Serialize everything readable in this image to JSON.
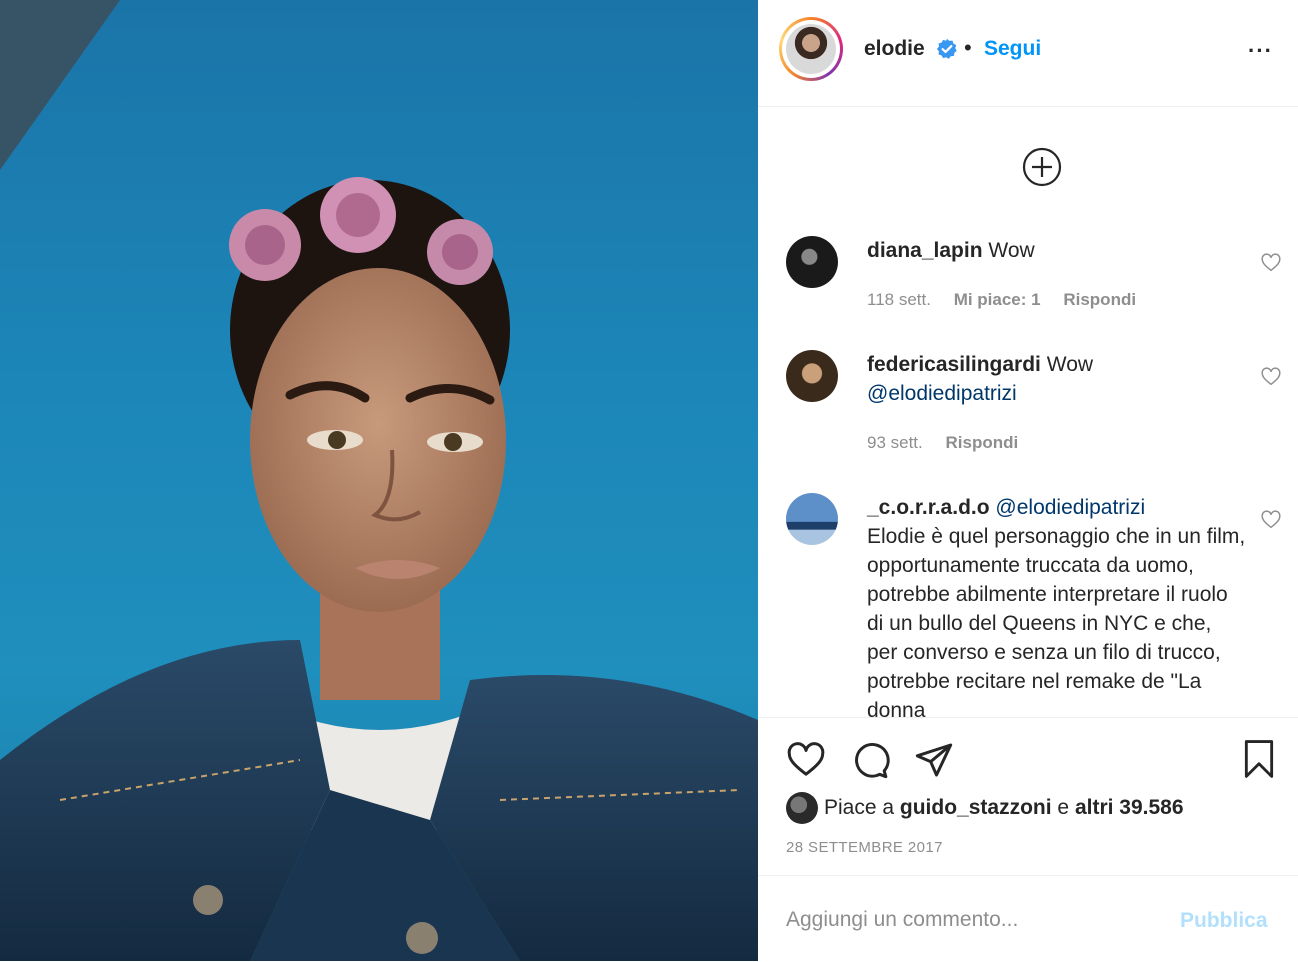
{
  "post": {
    "owner": "elodie",
    "separator": "•",
    "follow_label": "Segui",
    "more_label": "···",
    "photo_alt": "",
    "colors": {
      "accent": "#0095f6",
      "verified": "#3897f0",
      "muted": "#8e8e8e",
      "mention": "#00376b"
    }
  },
  "comments": [
    {
      "username": "diana_lapin",
      "text": "Wow",
      "time": "118 sett.",
      "likes": "Mi piace: 1",
      "reply": "Rispondi"
    },
    {
      "username": "federicasilingardi",
      "text": "Wow",
      "mention": "@elodiedipatrizi",
      "time": "93 sett.",
      "reply": "Rispondi"
    },
    {
      "username": "_c.o.r.r.a.d.o",
      "mention": "@elodiedipatrizi",
      "text": "Elodie è quel personaggio che in un film, opportunamente truccata da uomo, potrebbe abilmente interpretare il ruolo di un bullo del Queens in NYC e che, per converso e senza un filo di trucco, potrebbe recitare nel remake de \"La donna"
    }
  ],
  "likes": {
    "prefix": "Piace a",
    "user": "guido_stazzoni",
    "joiner": "e",
    "others": "altri 39.586"
  },
  "date": "28 SETTEMBRE 2017",
  "add_comment": {
    "placeholder": "Aggiungi un commento...",
    "publish_label": "Pubblica"
  }
}
